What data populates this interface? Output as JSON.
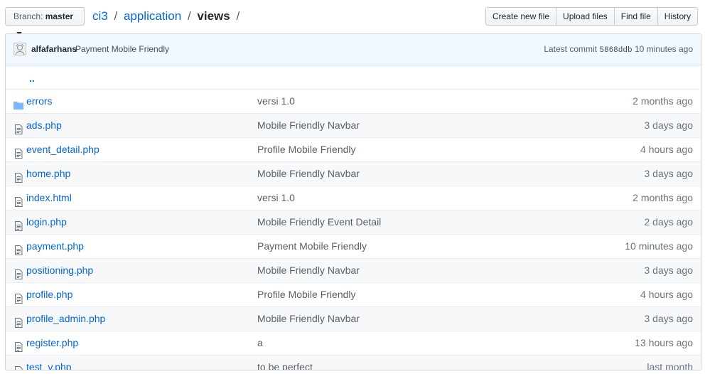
{
  "branch": {
    "label": "Branch:",
    "value": "master"
  },
  "breadcrumb": {
    "repo": "ci3",
    "sep1": "/",
    "dir": "application",
    "sep2": "/",
    "current": "views",
    "sep3": "/"
  },
  "actions": [
    "Create new file",
    "Upload files",
    "Find file",
    "History"
  ],
  "commit": {
    "author": "alfafarhans",
    "message": "Payment Mobile Friendly",
    "latest_label": "Latest commit",
    "sha": "5868ddb",
    "age": "10 minutes ago"
  },
  "updir": "..",
  "files": [
    {
      "type": "folder",
      "name": "errors",
      "message": "versi 1.0",
      "age": "2 months ago"
    },
    {
      "type": "file",
      "name": "ads.php",
      "message": "Mobile Friendly Navbar",
      "age": "3 days ago"
    },
    {
      "type": "file",
      "name": "event_detail.php",
      "message": "Profile Mobile Friendly",
      "age": "4 hours ago"
    },
    {
      "type": "file",
      "name": "home.php",
      "message": "Mobile Friendly Navbar",
      "age": "3 days ago"
    },
    {
      "type": "file",
      "name": "index.html",
      "message": "versi 1.0",
      "age": "2 months ago"
    },
    {
      "type": "file",
      "name": "login.php",
      "message": "Mobile Friendly Event Detail",
      "age": "2 days ago"
    },
    {
      "type": "file",
      "name": "payment.php",
      "message": "Payment Mobile Friendly",
      "age": "10 minutes ago"
    },
    {
      "type": "file",
      "name": "positioning.php",
      "message": "Mobile Friendly Navbar",
      "age": "3 days ago"
    },
    {
      "type": "file",
      "name": "profile.php",
      "message": "Profile Mobile Friendly",
      "age": "4 hours ago"
    },
    {
      "type": "file",
      "name": "profile_admin.php",
      "message": "Mobile Friendly Navbar",
      "age": "3 days ago"
    },
    {
      "type": "file",
      "name": "register.php",
      "message": "a",
      "age": "13 hours ago"
    },
    {
      "type": "file",
      "name": "test_v.php",
      "message": "to be perfect",
      "age": "last month"
    }
  ],
  "colors": {
    "link": "#0366d6",
    "commit_bg": "#f1f8ff",
    "folder_icon": "#79b8ff",
    "file_icon": "#6a737d"
  }
}
